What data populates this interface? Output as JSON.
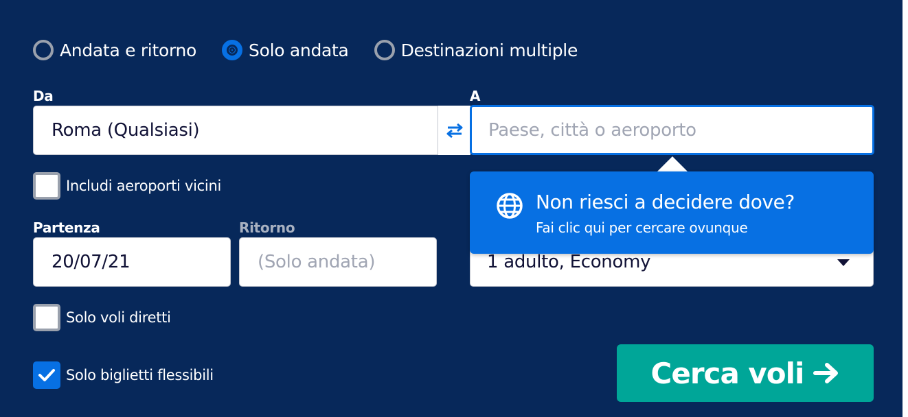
{
  "trip_type": {
    "options": [
      {
        "label": "Andata e ritorno",
        "selected": false
      },
      {
        "label": "Solo andata",
        "selected": true
      },
      {
        "label": "Destinazioni multiple",
        "selected": false
      }
    ]
  },
  "from": {
    "label": "Da",
    "value": "Roma (Qualsiasi)"
  },
  "to": {
    "label": "A",
    "value": "",
    "placeholder": "Paese, città o aeroporto"
  },
  "swap_icon": "swap-arrows-icon",
  "nearby_airports": {
    "label": "Includi aeroporti vicini",
    "checked": false
  },
  "popover": {
    "icon": "globe-icon",
    "title": "Non riesci a decidere dove?",
    "subtitle": "Fai clic qui per cercare ovunque"
  },
  "departure": {
    "label": "Partenza",
    "value": "20/07/21"
  },
  "return": {
    "label": "Ritorno",
    "placeholder": "(Solo andata)"
  },
  "passengers": {
    "value": "1 adulto, Economy"
  },
  "direct_only": {
    "label": "Solo voli diretti",
    "checked": false
  },
  "flexible_only": {
    "label": "Solo biglietti flessibili",
    "checked": true
  },
  "search_button": {
    "label": "Cerca voli",
    "icon": "arrow-right-icon"
  },
  "colors": {
    "background": "#07285a",
    "accent": "#0770e3",
    "search": "#00a698",
    "text_dark": "#111236"
  }
}
